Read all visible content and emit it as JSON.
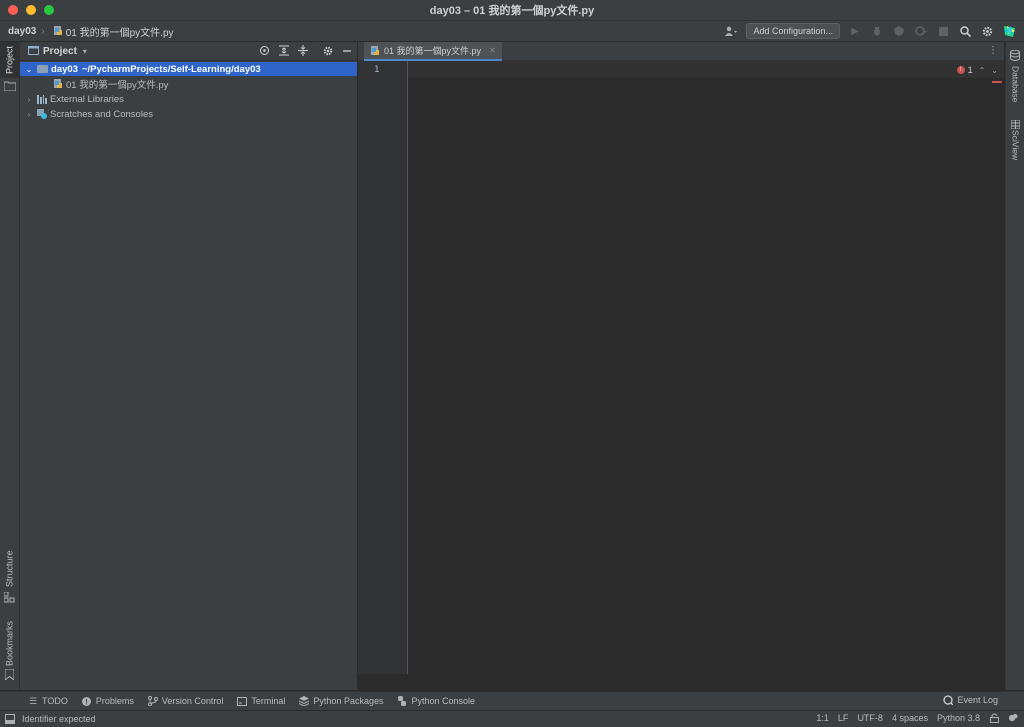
{
  "window": {
    "title": "day03 – 01 我的第一個py文件.py"
  },
  "navbar": {
    "root": "day03",
    "file": "01 我的第一個py文件.py",
    "add_configuration": "Add Configuration..."
  },
  "left_stripe": {
    "project_label": "Project",
    "structure_label": "Structure",
    "bookmarks_label": "Bookmarks"
  },
  "project_panel": {
    "title": "Project",
    "tree": {
      "root_name": "day03",
      "root_path": "~/PycharmProjects/Self-Learning/day03",
      "file_name": "01 我的第一個py文件.py",
      "external_libraries": "External Libraries",
      "scratches": "Scratches and Consoles"
    }
  },
  "editor": {
    "tab_label": "01 我的第一個py文件.py",
    "line_number": "1",
    "error_count": "1"
  },
  "right_stripe": {
    "database_label": "Database",
    "sciview_label": "SciView"
  },
  "tool_windows": {
    "todo": "TODO",
    "problems": "Problems",
    "version_control": "Version Control",
    "terminal": "Terminal",
    "python_packages": "Python Packages",
    "python_console": "Python Console",
    "event_log": "Event Log"
  },
  "status": {
    "message": "Identifier expected",
    "position": "1:1",
    "line_separator": "LF",
    "encoding": "UTF-8",
    "indent": "4 spaces",
    "interpreter": "Python 3.8"
  },
  "colors": {
    "accent": "#2f65ca",
    "error": "#c75450",
    "background": "#2b2b2b",
    "panel": "#3c3f41"
  }
}
